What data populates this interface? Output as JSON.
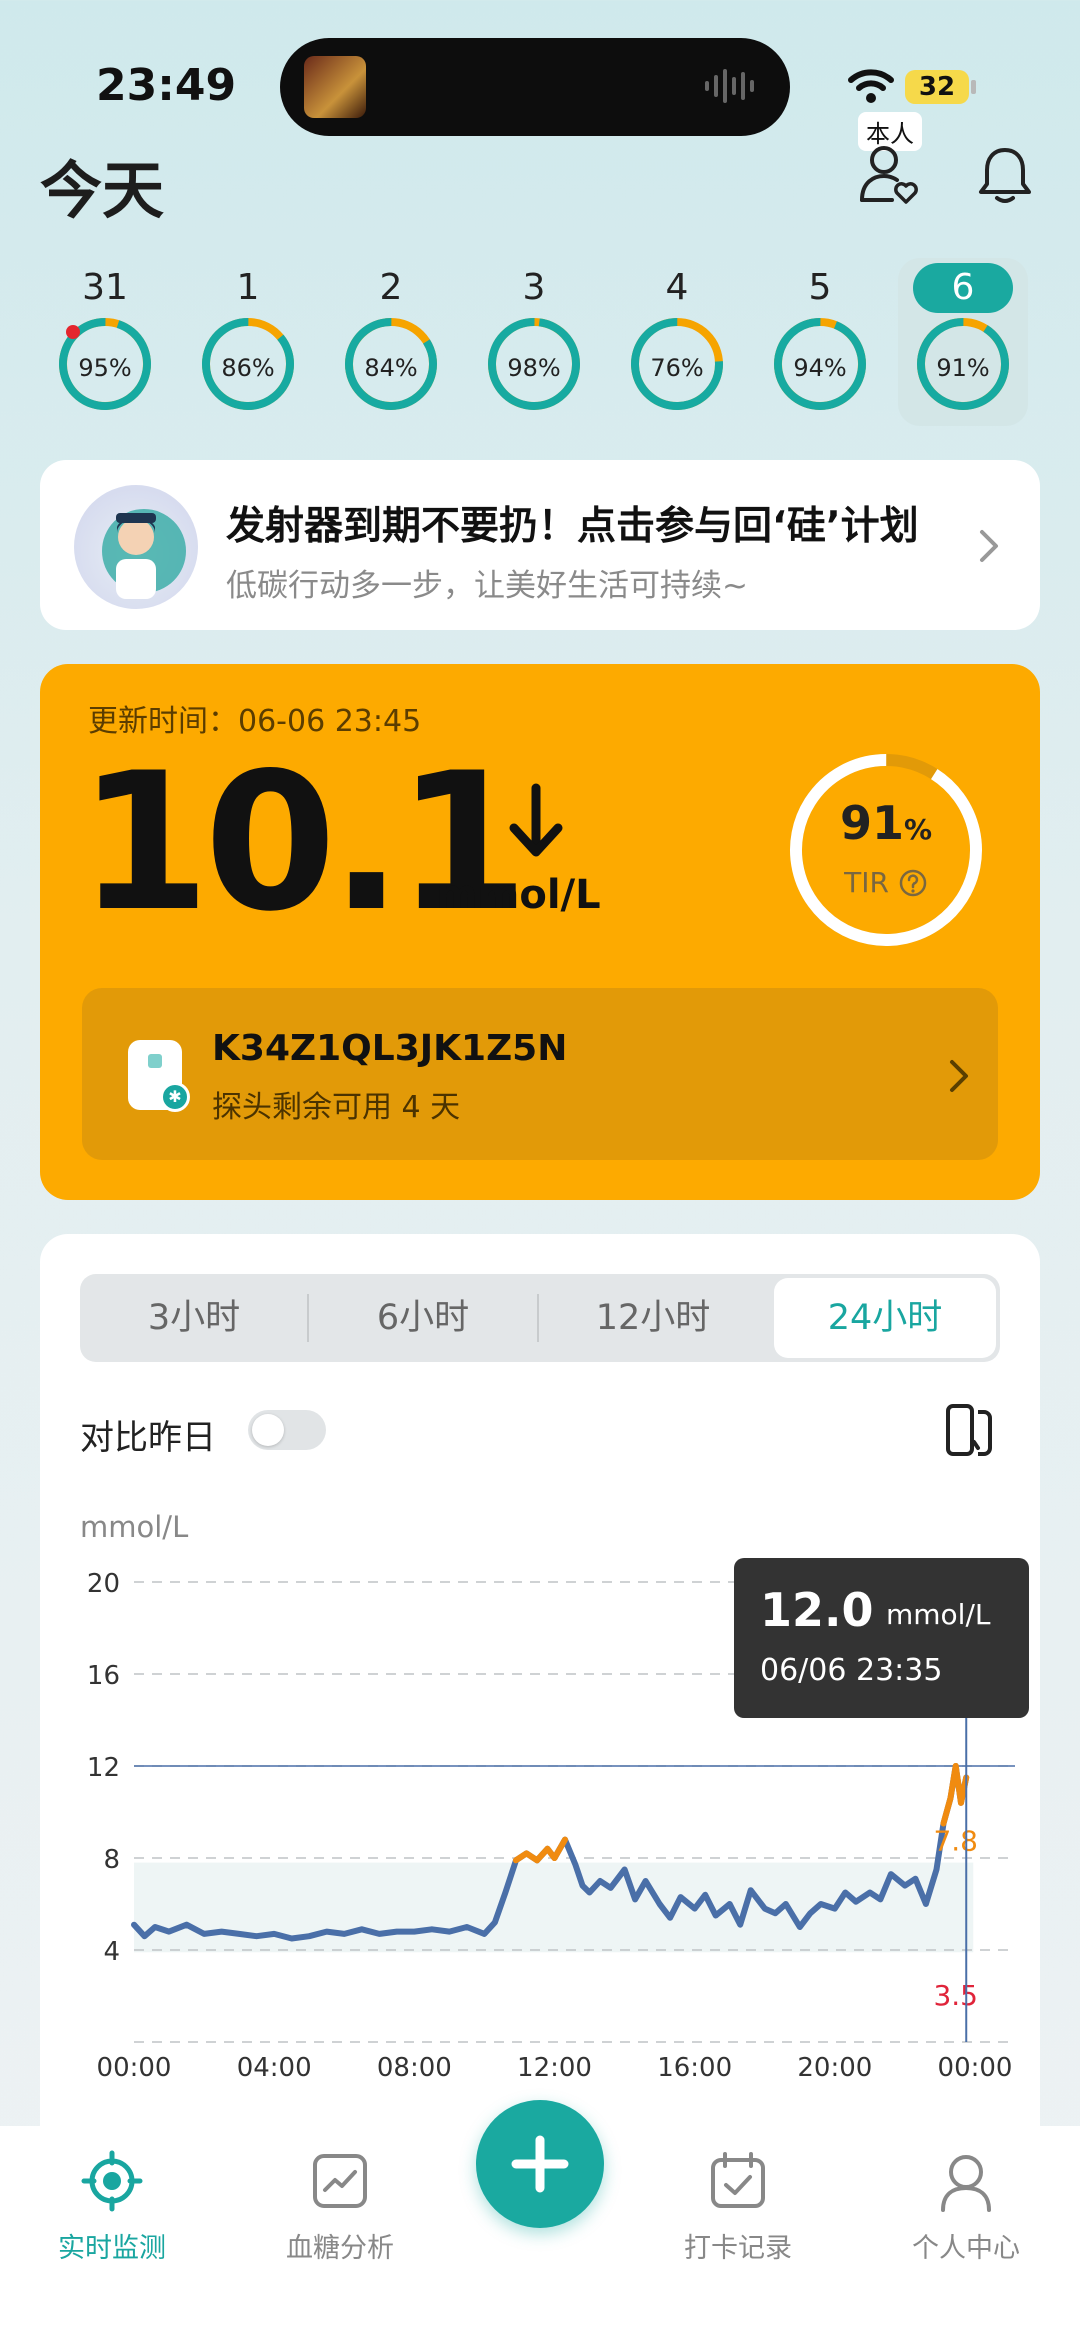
{
  "status_bar": {
    "time": "23:49",
    "battery": "32",
    "self_tag": "本人"
  },
  "header": {
    "title": "今天"
  },
  "days": [
    {
      "day": "31",
      "pct": "95%",
      "value": 0.95,
      "alert": true,
      "selected": false
    },
    {
      "day": "1",
      "pct": "86%",
      "value": 0.86,
      "alert": false,
      "selected": false
    },
    {
      "day": "2",
      "pct": "84%",
      "value": 0.84,
      "alert": false,
      "selected": false
    },
    {
      "day": "3",
      "pct": "98%",
      "value": 0.98,
      "alert": false,
      "selected": false
    },
    {
      "day": "4",
      "pct": "76%",
      "value": 0.76,
      "alert": false,
      "selected": false
    },
    {
      "day": "5",
      "pct": "94%",
      "value": 0.94,
      "alert": false,
      "selected": false
    },
    {
      "day": "6",
      "pct": "91%",
      "value": 0.91,
      "alert": false,
      "selected": true
    }
  ],
  "banner": {
    "title": "发射器到期不要扔！点击参与回‘硅’计划",
    "subtitle": "低碳行动多一步，让美好生活可持续~"
  },
  "glucose": {
    "updated": "更新时间：06-06 23:45",
    "value": "10.1",
    "unit": "mmol/L",
    "trend": "arrow-down",
    "tir_value": "91",
    "tir_percent_sign": "%",
    "tir_fraction": 0.91,
    "tir_label": "TIR"
  },
  "sensor": {
    "id": "K34Z1QL3JK1Z5N",
    "remaining": "探头剩余可用 4 天"
  },
  "range_tabs": [
    {
      "label": "3小时",
      "active": false
    },
    {
      "label": "6小时",
      "active": false
    },
    {
      "label": "12小时",
      "active": false
    },
    {
      "label": "24小时",
      "active": true
    }
  ],
  "compare": {
    "label": "对比昨日",
    "on": false
  },
  "chart_data": {
    "type": "line",
    "ylabel": "mmol/L",
    "y_ticks": [
      "4",
      "8",
      "12",
      "16",
      "20"
    ],
    "x_ticks": [
      "00:00",
      "04:00",
      "08:00",
      "12:00",
      "16:00",
      "20:00",
      "00:00"
    ],
    "ylim": [
      0,
      20
    ],
    "x_range_hours": [
      0,
      24
    ],
    "target_range": [
      3.9,
      7.8
    ],
    "target_high_label": "7.8",
    "target_low_label": "3.5",
    "tooltip_value": "12.0",
    "tooltip_unit": "mmol/L",
    "tooltip_time": "06/06 23:35",
    "colors": {
      "line": "#4a6fa8",
      "high": "#f08b10",
      "low_label": "#e0243a",
      "band": "#eef5f5"
    },
    "series": [
      {
        "x": [
          0,
          0.3,
          0.6,
          1,
          1.5,
          2,
          2.5,
          3,
          3.5,
          4,
          4.5,
          5,
          5.5,
          6,
          6.5,
          7,
          7.5,
          8,
          8.5,
          9,
          9.5,
          10,
          10.3,
          10.6,
          10.9,
          11.2,
          11.5,
          11.8,
          12,
          12.3,
          12.6,
          12.8,
          13,
          13.3,
          13.6,
          14,
          14.3,
          14.6,
          15,
          15.3,
          15.6,
          16,
          16.3,
          16.6,
          17,
          17.3,
          17.6,
          18,
          18.3,
          18.6,
          19,
          19.3,
          19.6,
          20,
          20.3,
          20.6,
          21,
          21.3,
          21.6,
          22,
          22.3,
          22.6,
          22.9,
          23.1,
          23.3,
          23.45,
          23.6,
          23.75
        ],
        "y": [
          5.1,
          4.6,
          5.0,
          4.8,
          5.1,
          4.7,
          4.8,
          4.7,
          4.6,
          4.7,
          4.5,
          4.6,
          4.8,
          4.7,
          4.9,
          4.7,
          4.8,
          4.8,
          4.9,
          4.8,
          5.0,
          4.7,
          5.2,
          6.5,
          7.9,
          8.2,
          7.9,
          8.4,
          8.0,
          8.8,
          7.7,
          6.8,
          6.5,
          7.0,
          6.7,
          7.5,
          6.2,
          7.0,
          6.0,
          5.4,
          6.3,
          5.8,
          6.4,
          5.5,
          6.0,
          5.1,
          6.6,
          5.8,
          5.6,
          6.0,
          5.0,
          5.6,
          6.0,
          5.8,
          6.5,
          6.1,
          6.5,
          6.2,
          7.3,
          6.8,
          7.1,
          6.0,
          7.5,
          9.5,
          10.6,
          12.0,
          10.4,
          11.5
        ]
      }
    ]
  },
  "nav": [
    {
      "label": "实时监测",
      "active": true
    },
    {
      "label": "血糖分析",
      "active": false
    },
    {
      "label": "打卡记录",
      "active": false
    },
    {
      "label": "个人中心",
      "active": false
    }
  ]
}
